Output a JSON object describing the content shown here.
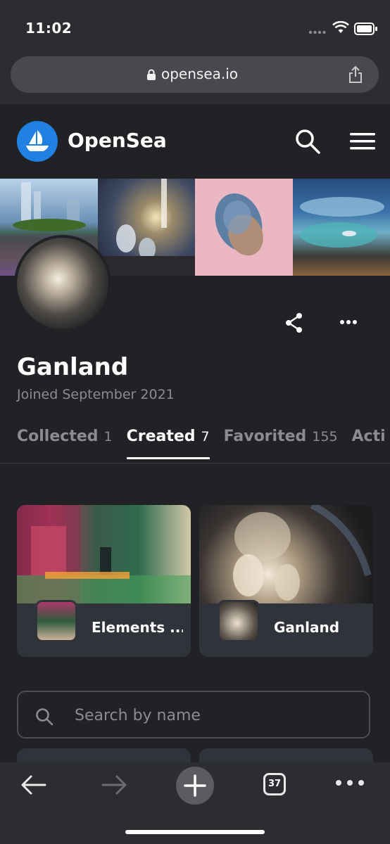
{
  "status_bar": {
    "time": "11:02"
  },
  "browser": {
    "url": "opensea.io"
  },
  "site": {
    "brand": "OpenSea"
  },
  "profile": {
    "name": "Ganland",
    "joined": "Joined September 2021"
  },
  "tabs": [
    {
      "label": "Collected",
      "count": "1"
    },
    {
      "label": "Created",
      "count": "7",
      "active": true
    },
    {
      "label": "Favorited",
      "count": "155"
    },
    {
      "label": "Acti",
      "count": ""
    }
  ],
  "collections": [
    {
      "name": "Elements ..."
    },
    {
      "name": "Ganland"
    }
  ],
  "search": {
    "placeholder": "Search by name"
  },
  "toolbar": {
    "tab_count": "37"
  },
  "colors": {
    "background": "#202225",
    "card": "#303339",
    "brand_blue": "#2081e2",
    "muted_text": "#8a8c90"
  }
}
